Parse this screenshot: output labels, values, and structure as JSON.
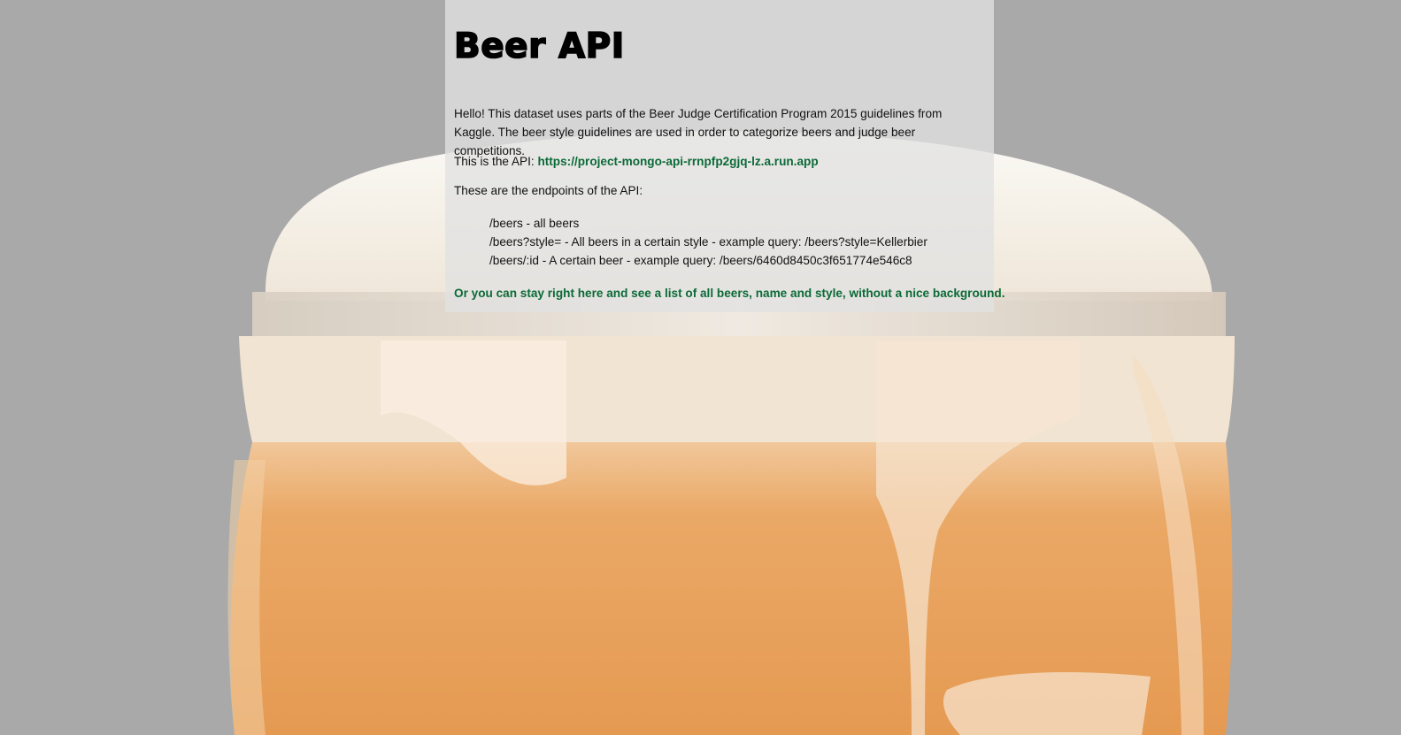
{
  "page": {
    "title": "Beer API",
    "intro": "Hello! This dataset uses parts of the Beer Judge Certification Program 2015 guidelines from Kaggle. The beer style guidelines are used in order to categorize beers and judge beer competitions.",
    "api_prefix": "This is the API: ",
    "api_url": "https://project-mongo-api-rrnpfp2gjq-lz.a.run.app",
    "endpoints_heading": "These are the endpoints of the API:",
    "endpoints": [
      "/beers - all beers",
      "/beers?style= - All beers in a certain style - example query: /beers?style=Kellerbier",
      "/beers/:id - A certain beer - example query: /beers/6460d8450c3f651774e546c8"
    ],
    "stay_link": "Or you can stay right here and see a list of all beers, name and style, without a nice background."
  },
  "colors": {
    "page_background": "#a9a9a9",
    "panel_background": "#e1e1e1",
    "link_green": "#0b6a37",
    "beer_orange": "#e8a25a",
    "foam": "#f4f1ea"
  },
  "icons": {
    "background_image": "beer-glass-photo"
  }
}
